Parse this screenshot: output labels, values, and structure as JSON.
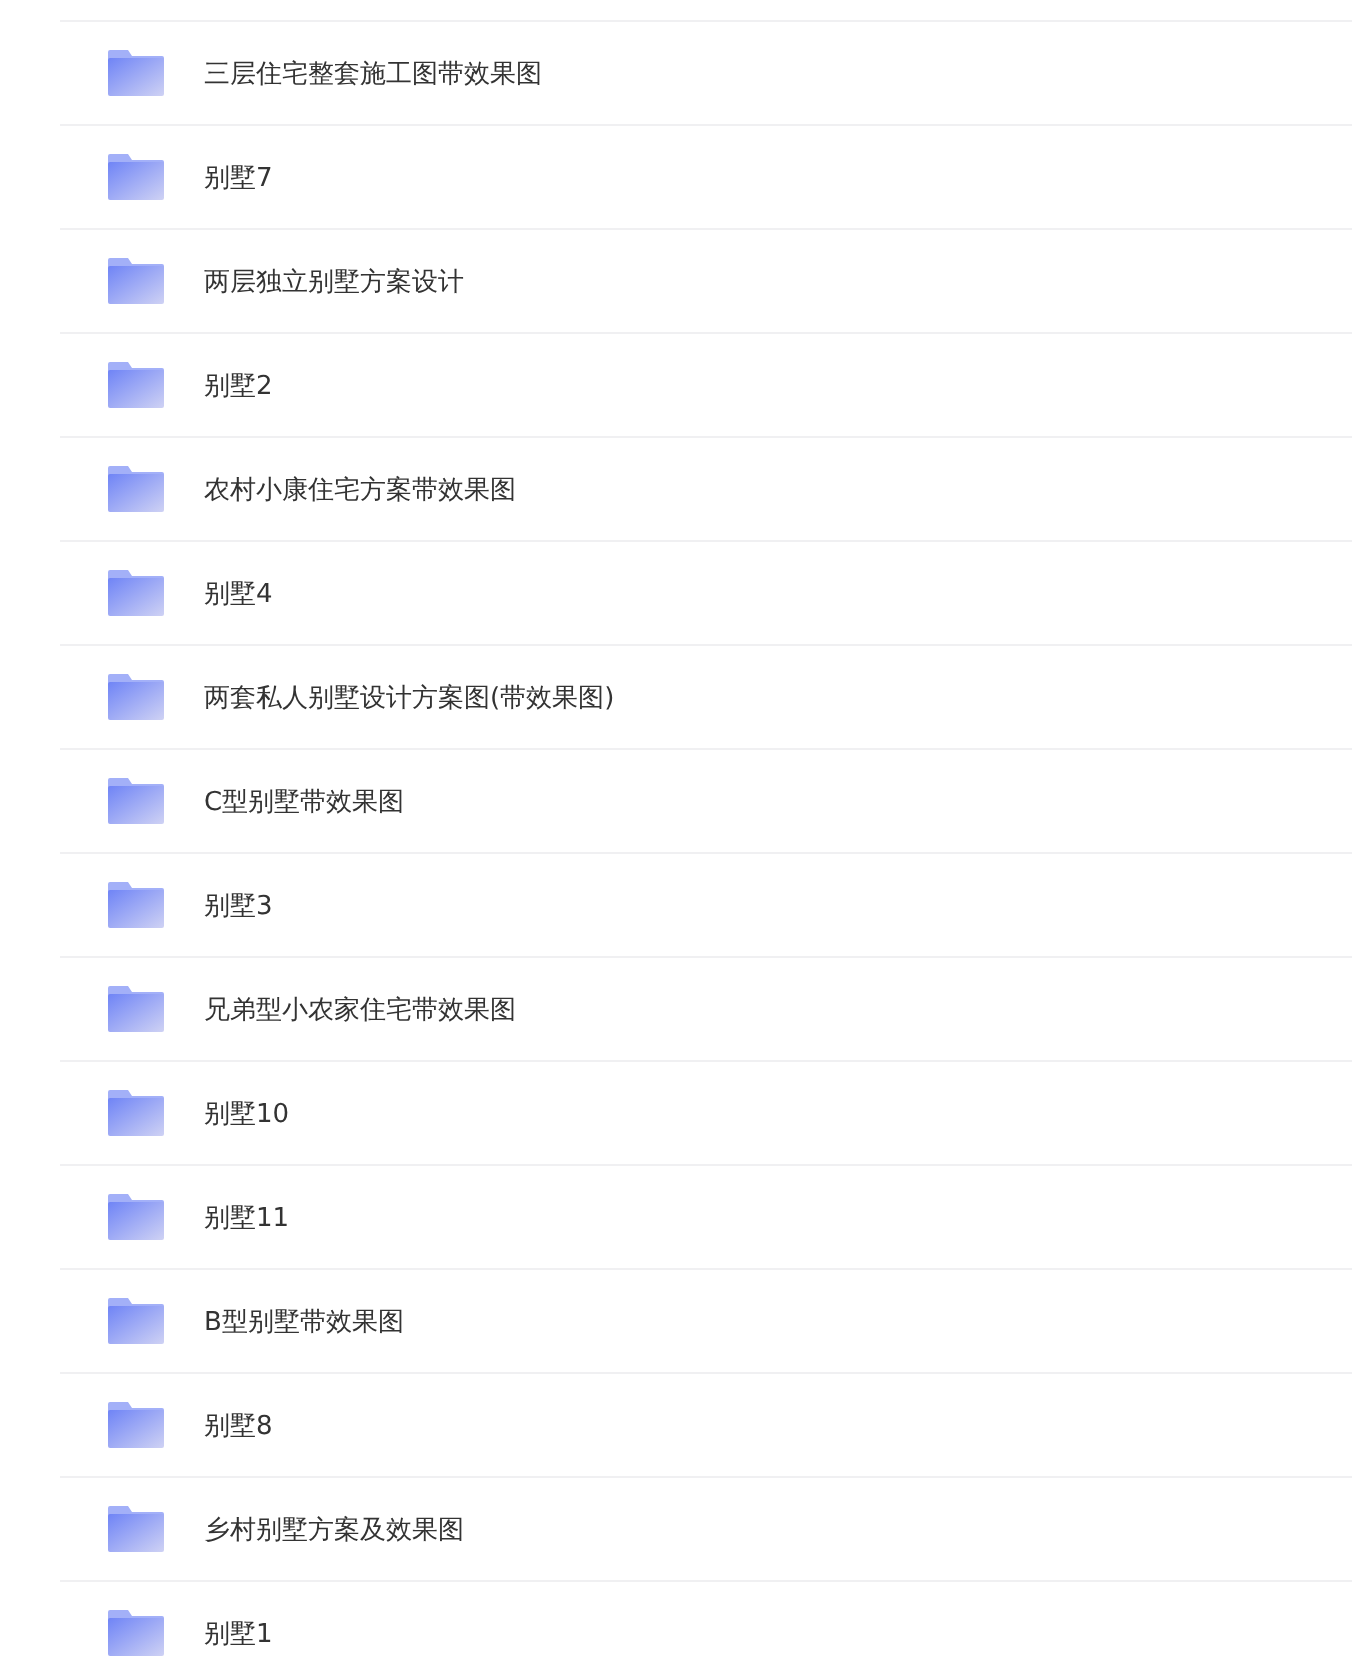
{
  "folders": [
    {
      "name": "三层住宅整套施工图带效果图"
    },
    {
      "name": "别墅7"
    },
    {
      "name": "两层独立别墅方案设计"
    },
    {
      "name": "别墅2"
    },
    {
      "name": "农村小康住宅方案带效果图"
    },
    {
      "name": "别墅4"
    },
    {
      "name": "两套私人别墅设计方案图(带效果图)"
    },
    {
      "name": "C型别墅带效果图"
    },
    {
      "name": "别墅3"
    },
    {
      "name": "兄弟型小农家住宅带效果图"
    },
    {
      "name": "别墅10"
    },
    {
      "name": "别墅11"
    },
    {
      "name": "B型别墅带效果图"
    },
    {
      "name": "别墅8"
    },
    {
      "name": "乡村别墅方案及效果图"
    },
    {
      "name": "别墅1"
    }
  ]
}
